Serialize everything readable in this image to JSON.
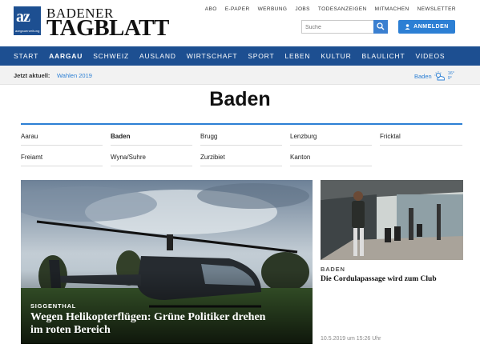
{
  "logo": {
    "badge_text": "az",
    "badge_sub": "aargauerzeitung",
    "line1": "BADENER",
    "line2": "TAGBLATT"
  },
  "util_links": [
    "ABO",
    "E-PAPER",
    "WERBUNG",
    "JOBS",
    "TODESANZEIGEN",
    "MITMACHEN",
    "NEWSLETTER"
  ],
  "search": {
    "placeholder": "Suche",
    "icon": "search-icon"
  },
  "login": {
    "label": "ANMELDEN",
    "icon": "user-icon"
  },
  "nav": [
    "START",
    "AARGAU",
    "SCHWEIZ",
    "AUSLAND",
    "WIRTSCHAFT",
    "SPORT",
    "LEBEN",
    "KULTUR",
    "BLAULICHT",
    "VIDEOS"
  ],
  "nav_active": "AARGAU",
  "current": {
    "label": "Jetzt aktuell:",
    "link": "Wahlen 2019"
  },
  "weather": {
    "city": "Baden",
    "icon": "partly-cloudy-icon",
    "high": "16°",
    "low": "9°"
  },
  "page_title": "Baden",
  "regions": [
    [
      "Aarau",
      "Baden",
      "Brugg",
      "Lenzburg",
      "Fricktal"
    ],
    [
      "Freiamt",
      "Wyna/Suhre",
      "Zurzibiet",
      "Kanton"
    ]
  ],
  "region_active": "Baden",
  "main_article": {
    "kicker": "SIGGENTHAL",
    "headline": "Wegen Helikopterflügen: Grüne Politiker drehen im roten Bereich"
  },
  "side_article": {
    "kicker": "BADEN",
    "headline": "Die Cordulapassage wird zum Club",
    "time": "10.5.2019 um 15:26 Uhr"
  },
  "colors": {
    "brand_blue": "#1d4f91",
    "accent_blue": "#2c7fd4"
  }
}
